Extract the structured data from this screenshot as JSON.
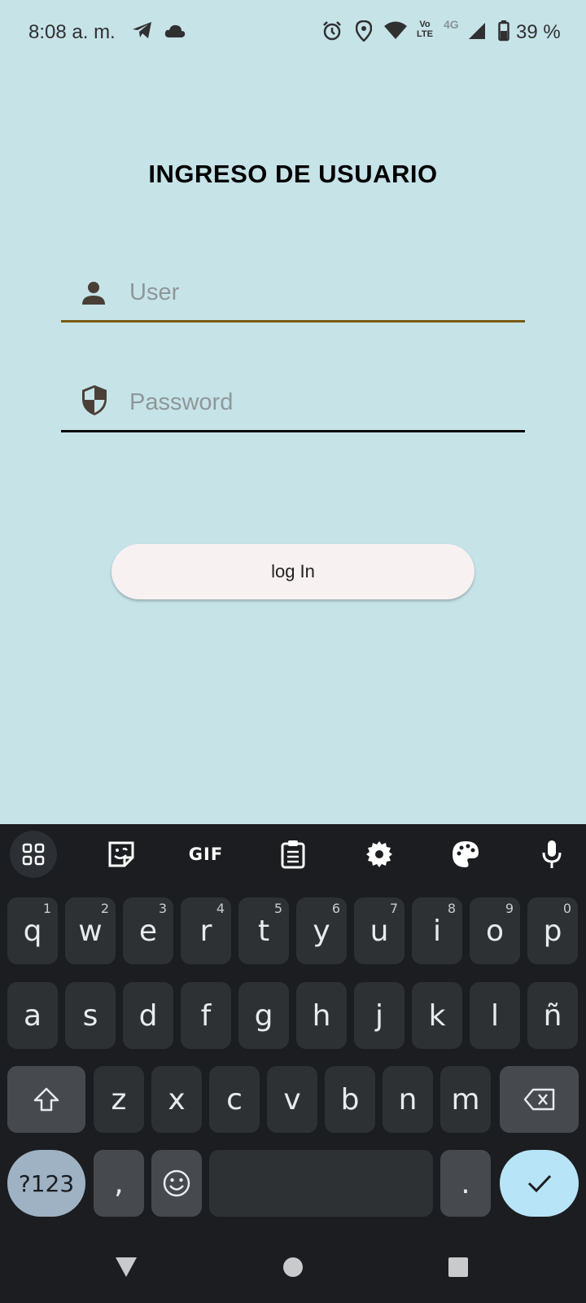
{
  "status_bar": {
    "time": "8:08 a. m.",
    "network_label": "Vo LTE",
    "network_type": "4G",
    "battery_percent": "39 %",
    "icons": [
      "telegram-icon",
      "cloud-icon",
      "alarm-icon",
      "location-icon",
      "wifi-icon",
      "volte-icon",
      "signal-icon",
      "battery-icon"
    ]
  },
  "page": {
    "title": "INGRESO DE USUARIO"
  },
  "form": {
    "user": {
      "value": "",
      "placeholder": "User",
      "icon": "person-icon"
    },
    "password": {
      "value": "",
      "placeholder": "Password",
      "icon": "shield-icon"
    },
    "login_label": "log In"
  },
  "keyboard": {
    "toolbar": [
      "apps-grid-icon",
      "sticker-icon",
      "GIF",
      "clipboard-icon",
      "settings-icon",
      "palette-icon",
      "microphone-icon"
    ],
    "gif_label": "GIF",
    "row1": [
      {
        "k": "q",
        "h": "1"
      },
      {
        "k": "w",
        "h": "2"
      },
      {
        "k": "e",
        "h": "3"
      },
      {
        "k": "r",
        "h": "4"
      },
      {
        "k": "t",
        "h": "5"
      },
      {
        "k": "y",
        "h": "6"
      },
      {
        "k": "u",
        "h": "7"
      },
      {
        "k": "i",
        "h": "8"
      },
      {
        "k": "o",
        "h": "9"
      },
      {
        "k": "p",
        "h": "0"
      }
    ],
    "row2": [
      "a",
      "s",
      "d",
      "f",
      "g",
      "h",
      "j",
      "k",
      "l",
      "ñ"
    ],
    "row3": [
      "z",
      "x",
      "c",
      "v",
      "b",
      "n",
      "m"
    ],
    "symbols_label": "?123",
    "comma": ",",
    "period": "."
  },
  "colors": {
    "background": "#c6e3e8",
    "user_underline": "#7a5a10",
    "keyboard_bg": "#1b1d20",
    "enter_key": "#b8e4f7"
  }
}
